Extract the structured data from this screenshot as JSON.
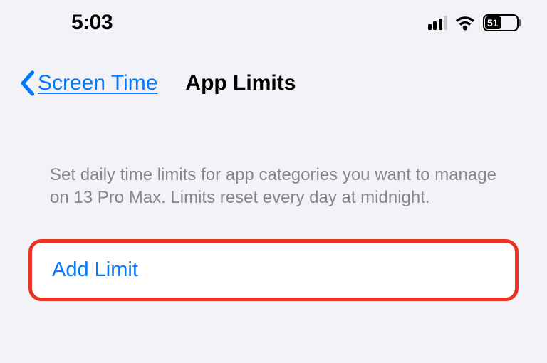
{
  "status": {
    "time": "5:03",
    "battery_level": "51"
  },
  "nav": {
    "back_label": "Screen Time",
    "title": "App Limits"
  },
  "description": "Set daily time limits for app categories you want to manage on 13 Pro Max. Limits reset every day at midnight.",
  "actions": {
    "add_limit": "Add Limit"
  }
}
